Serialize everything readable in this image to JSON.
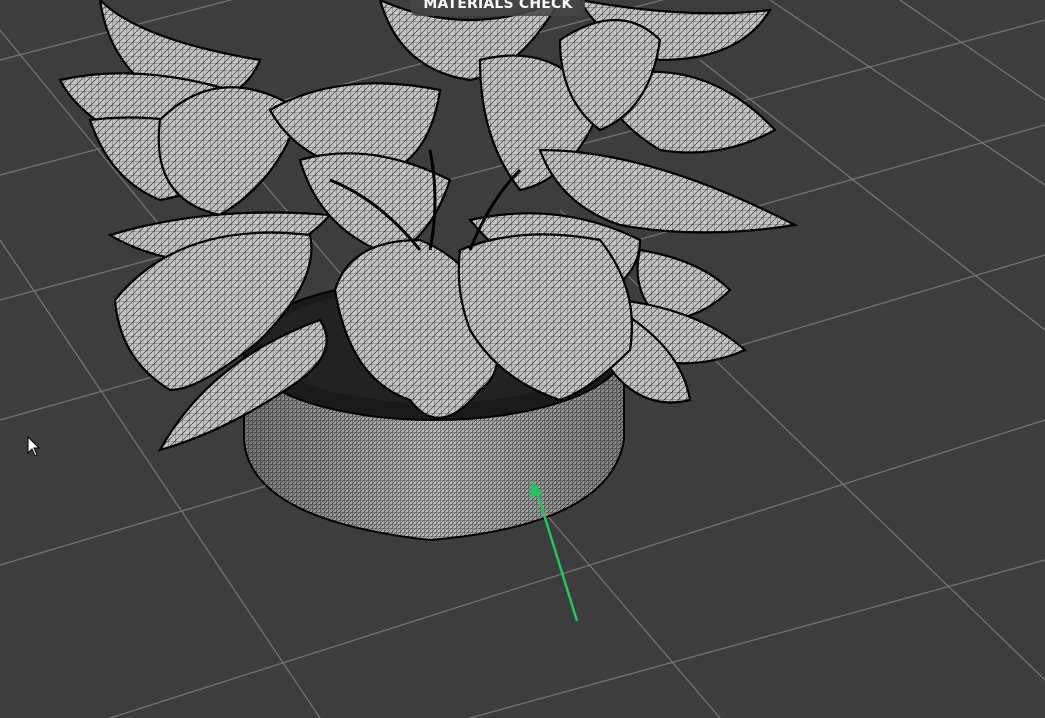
{
  "viewport": {
    "title": "MATERIALS CHECK",
    "background_color": "#3d3d3d",
    "grid_color": "#7a7a7a",
    "mesh_fill_color": "#c8c8c8",
    "wire_color": "#111111",
    "annotation_arrow_color": "#22c55e",
    "icons": [
      "mouse-pointer-icon",
      "annotation-arrow-icon"
    ]
  }
}
